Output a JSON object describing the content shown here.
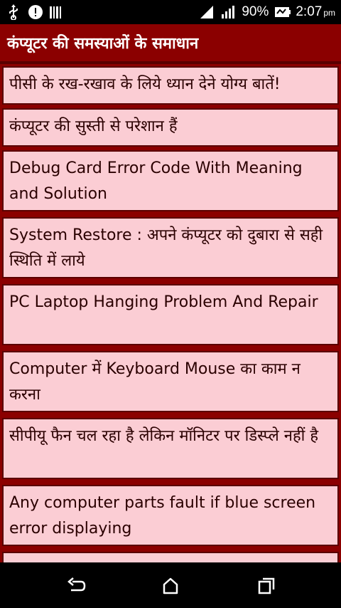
{
  "status_bar": {
    "battery_percent": "90%",
    "time": "2:07",
    "time_suffix": "pm",
    "icons": [
      "usb-icon",
      "cloud-upload-icon",
      "barcode-icon",
      "wifi-icon",
      "signal-icon",
      "battery-icon"
    ]
  },
  "header": {
    "title": "कंप्यूटर की समस्याओं के समाधान"
  },
  "list": {
    "items": [
      {
        "label": "पीसी के रख-रखाव के लिये ध्यान देने योग्य बातें!"
      },
      {
        "label": "कंप्यूटर की सुस्ती से परेशान हैं"
      },
      {
        "label": "Debug Card Error Code With Meaning and Solution"
      },
      {
        "label": "System Restore : अपने कंप्यूटर को दुबारा से सही स्थिति में लाये"
      },
      {
        "label": "PC Laptop Hanging Problem And Repair"
      },
      {
        "label": "Computer में Keyboard Mouse का काम न करना"
      },
      {
        "label": "सीपीयू फैन चल रहा है लेकिन मॉनिटर पर डिस्प्ले नहीं है"
      },
      {
        "label": "Any computer parts fault if blue screen error displaying"
      }
    ]
  },
  "nav_bar": {
    "buttons": [
      "back-icon",
      "home-icon",
      "recent-apps-icon"
    ]
  },
  "colors": {
    "header_bg": "#8b0000",
    "item_bg": "#fbcdd4",
    "item_border": "#5a0000"
  }
}
